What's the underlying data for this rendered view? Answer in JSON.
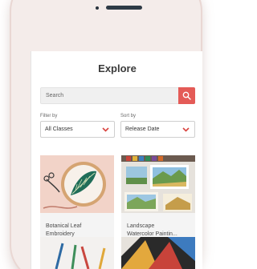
{
  "header": {
    "title": "Explore"
  },
  "search": {
    "placeholder": "Search",
    "icon": "search-icon"
  },
  "filters": {
    "filter_by": {
      "label": "Filter by",
      "value": "All Classes"
    },
    "sort_by": {
      "label": "Sort by",
      "value": "Release Date"
    }
  },
  "classes": [
    {
      "line1": "Botanical Leaf",
      "line2": "Embroidery"
    },
    {
      "line1": "Landscape",
      "line2": "Watercolor Paintin..."
    }
  ],
  "colors": {
    "accent": "#e45b57",
    "chevron": "#d9443f",
    "phone_frame": "#f4ecea"
  }
}
